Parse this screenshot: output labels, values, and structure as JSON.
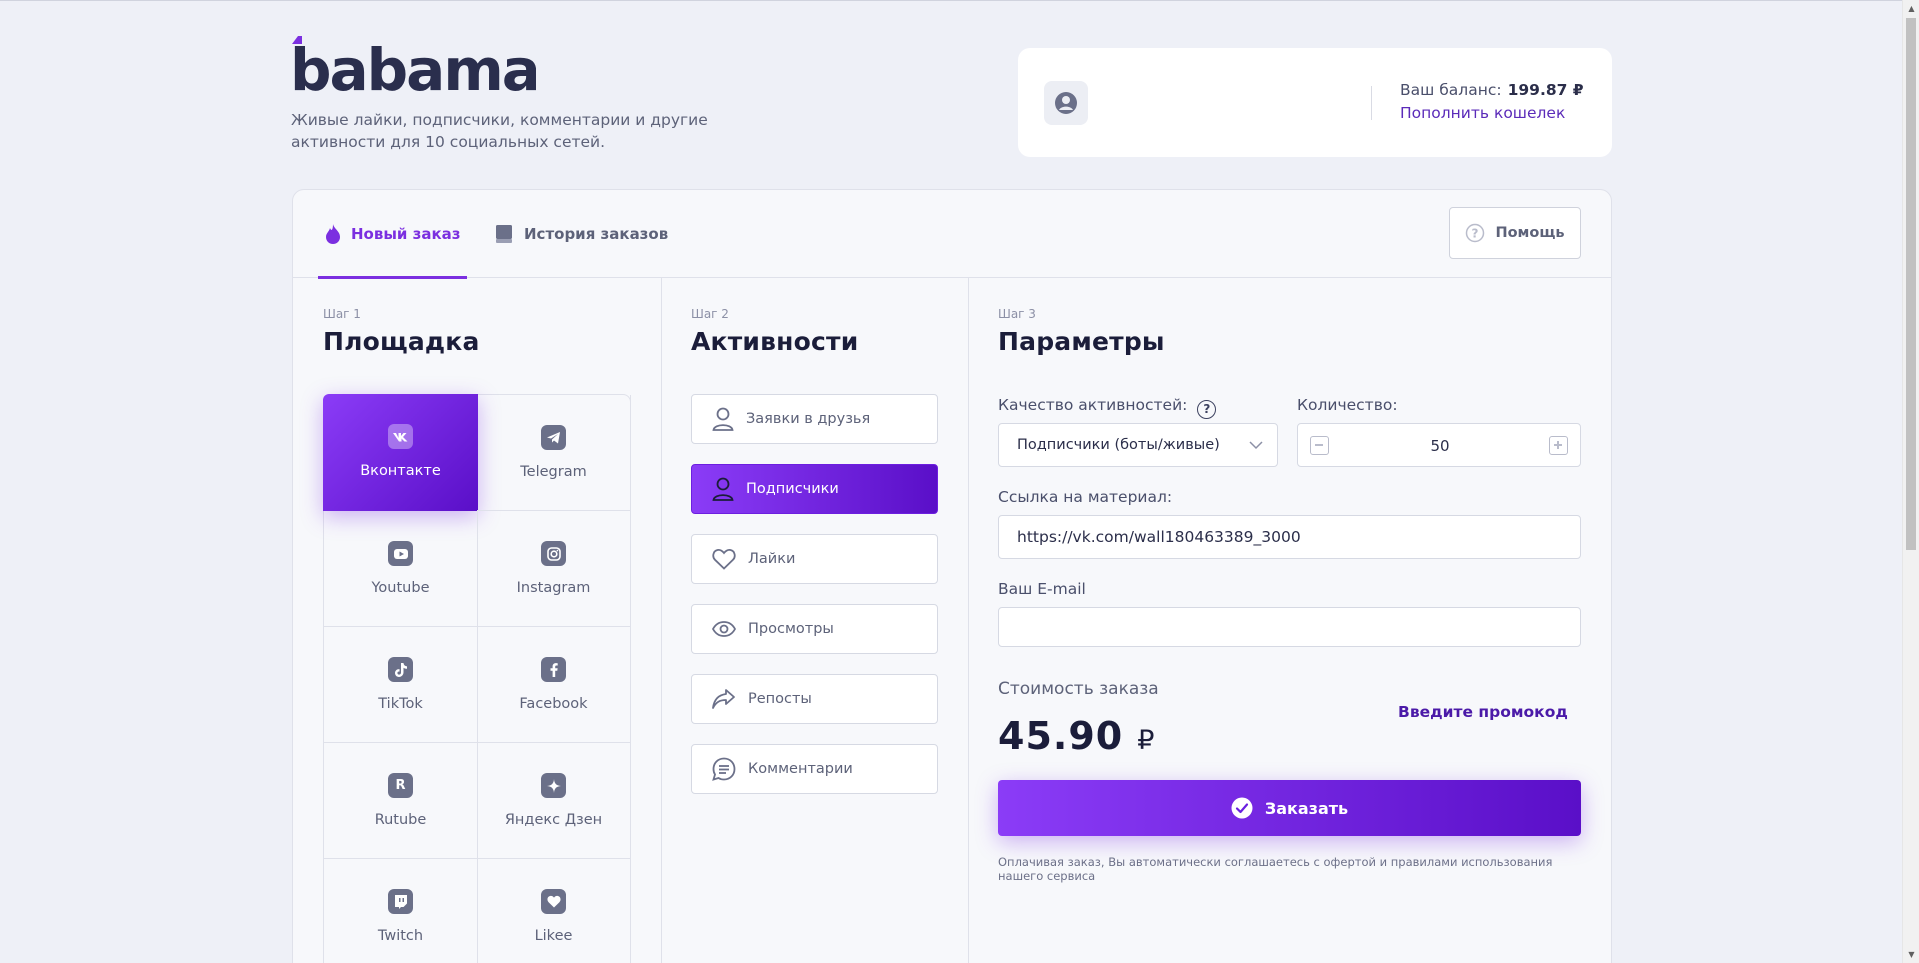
{
  "header": {
    "logo_text": "babama",
    "tagline": "Живые лайки, подписчики, комментарии и другие активности для 10 социальных сетей."
  },
  "account": {
    "balance_label": "Ваш баланс:",
    "balance_value": "199.87 ₽",
    "topup_label": "Пополнить кошелек"
  },
  "tabs": {
    "new_order": "Новый заказ",
    "history": "История заказов",
    "help": "Помощь"
  },
  "step1": {
    "step": "Шаг 1",
    "title": "Площадка",
    "platforms": [
      {
        "label": "Вконтакте",
        "icon": "vk-icon"
      },
      {
        "label": "Telegram",
        "icon": "telegram-icon"
      },
      {
        "label": "Youtube",
        "icon": "youtube-icon"
      },
      {
        "label": "Instagram",
        "icon": "instagram-icon"
      },
      {
        "label": "TikTok",
        "icon": "tiktok-icon"
      },
      {
        "label": "Facebook",
        "icon": "facebook-icon"
      },
      {
        "label": "Rutube",
        "icon": "rutube-icon"
      },
      {
        "label": "Яндекс Дзен",
        "icon": "zen-icon"
      },
      {
        "label": "Twitch",
        "icon": "twitch-icon"
      },
      {
        "label": "Likee",
        "icon": "likee-icon"
      }
    ],
    "selected": "Вконтакте"
  },
  "step2": {
    "step": "Шаг 2",
    "title": "Активности",
    "activities": [
      {
        "label": "Заявки в друзья",
        "icon": "user-icon"
      },
      {
        "label": "Подписчики",
        "icon": "user-icon"
      },
      {
        "label": "Лайки",
        "icon": "heart-icon"
      },
      {
        "label": "Просмотры",
        "icon": "eye-icon"
      },
      {
        "label": "Репосты",
        "icon": "share-icon"
      },
      {
        "label": "Комментарии",
        "icon": "comment-icon"
      }
    ],
    "selected": "Подписчики"
  },
  "step3": {
    "step": "Шаг 3",
    "title": "Параметры",
    "quality_label": "Качество активностей:",
    "quality_help": "?",
    "quality_value": "Подписчики (боты/живые)",
    "quantity_label": "Количество:",
    "quantity_value": "50",
    "link_label": "Ссылка на материал:",
    "link_value": "https://vk.com/wall180463389_3000",
    "email_label": "Ваш E-mail",
    "email_value": "",
    "cost_label": "Стоимость заказа",
    "cost_value": "45.90",
    "cost_currency": "₽",
    "promo_label": "Введите промокод",
    "order_button": "Заказать",
    "disclaimer": "Оплачивая заказ, Вы автоматически соглашаетесь с офертой и правилами использования нашего сервиса"
  },
  "colors": {
    "accent": "#7b2fe0",
    "accent_dark": "#5a0fc8",
    "background": "#eef0f7"
  }
}
